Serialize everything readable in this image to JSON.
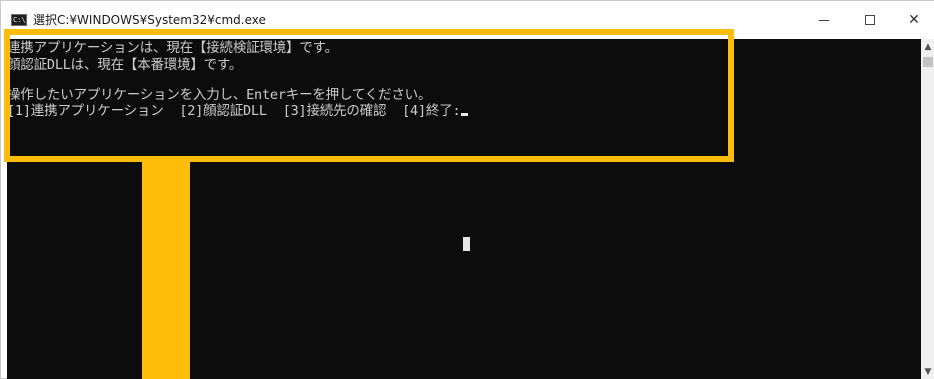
{
  "window": {
    "title": "選択C:¥WINDOWS¥System32¥cmd.exe",
    "app_icon": "cmd-icon",
    "app_icon_text": "C:\\",
    "caption_buttons": {
      "minimize_icon": "minimize-icon",
      "maximize_icon": "maximize-icon",
      "close_icon": "close-icon",
      "close_glyph": "✕"
    }
  },
  "console": {
    "lines": [
      "連携アプリケーションは、現在【接続検証環境】です。",
      "顔認証DLLは、現在【本番環境】です。",
      "操作したいアプリケーションを入力し、Enterキーを押してください。",
      "[1]連携アプリケーション  [2]顔認証DLL  [3]接続先の確認  [4]終了:"
    ],
    "text_color": "#cccccc",
    "background": "#0c0c0c"
  },
  "scrollbar": {
    "up_icon": "scroll-up-arrow-icon",
    "down_icon": "scroll-down-arrow-icon",
    "up_glyph": "▲",
    "down_glyph": "▼"
  },
  "annotation": {
    "color": "#ffbd0a"
  }
}
